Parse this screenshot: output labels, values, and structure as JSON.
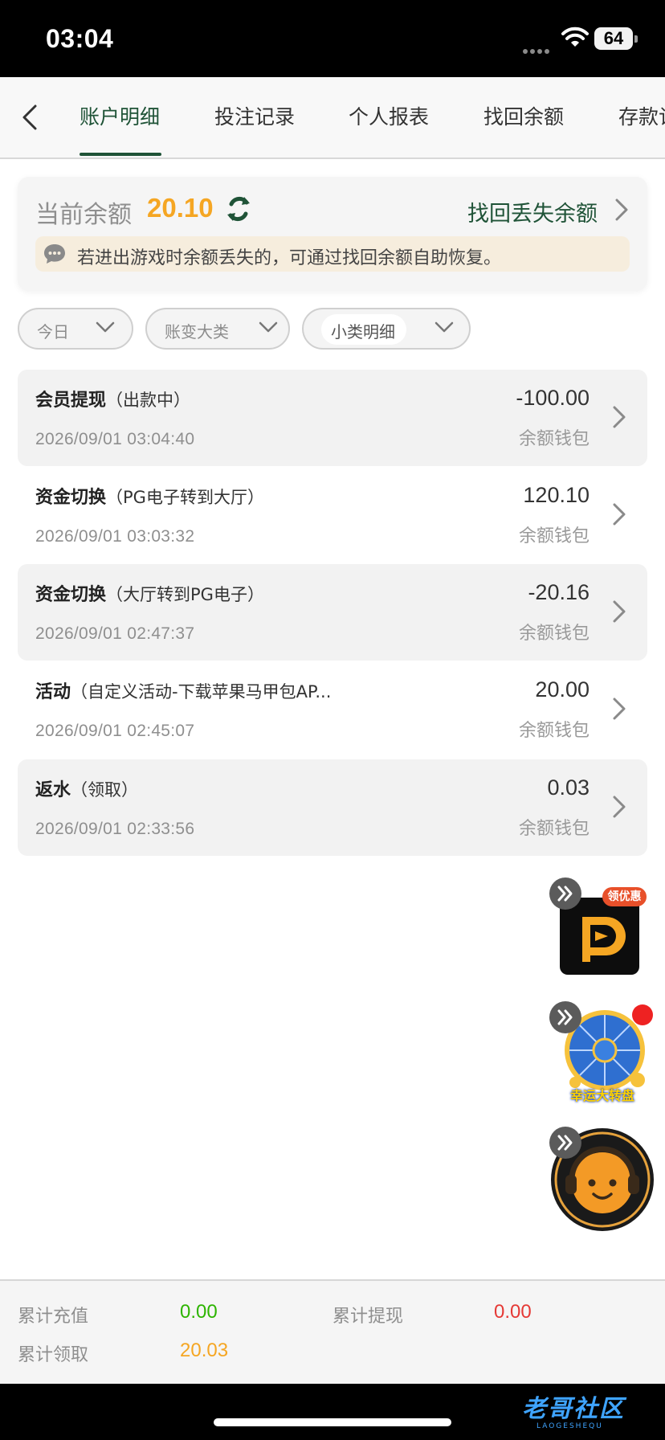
{
  "status_bar": {
    "time": "03:04",
    "battery": "64"
  },
  "tabs": [
    {
      "label": "账户明细",
      "active": true
    },
    {
      "label": "投注记录",
      "active": false
    },
    {
      "label": "个人报表",
      "active": false
    },
    {
      "label": "找回余额",
      "active": false
    },
    {
      "label": "存款记",
      "active": false
    }
  ],
  "balance": {
    "label": "当前余额",
    "value": "20.10",
    "recover_link": "找回丢失余额",
    "notice": "若进出游戏时余额丢失的，可通过找回余额自助恢复。"
  },
  "filters": [
    {
      "label": "今日"
    },
    {
      "label": "账变大类"
    },
    {
      "label": "小类明细"
    }
  ],
  "records": [
    {
      "type": "会员提现",
      "sub": "（出款中）",
      "time": "2026/09/01 03:04:40",
      "amount": "-100.00",
      "wallet": "余额钱包"
    },
    {
      "type": "资金切换",
      "sub": "（PG电子转到大厅）",
      "time": "2026/09/01 03:03:32",
      "amount": "120.10",
      "wallet": "余额钱包"
    },
    {
      "type": "资金切换",
      "sub": "（大厅转到PG电子）",
      "time": "2026/09/01 02:47:37",
      "amount": "-20.16",
      "wallet": "余额钱包"
    },
    {
      "type": "活动",
      "sub": "（自定义活动-下载苹果马甲包AP...",
      "time": "2026/09/01 02:45:07",
      "amount": "20.00",
      "wallet": "余额钱包"
    },
    {
      "type": "返水",
      "sub": "（领取）",
      "time": "2026/09/01 02:33:56",
      "amount": "0.03",
      "wallet": "余额钱包"
    }
  ],
  "floats": {
    "promo_badge": "领优惠",
    "wheel_label": "幸运大转盘"
  },
  "summary": {
    "recharge_label": "累计充值",
    "recharge_value": "0.00",
    "withdraw_label": "累计提现",
    "withdraw_value": "0.00",
    "claim_label": "累计领取",
    "claim_value": "20.03"
  },
  "watermark": {
    "text": "老哥社区",
    "sub": "LAOGESHEQU"
  },
  "colors": {
    "accent": "#1f5337",
    "balance": "#f5a623",
    "green": "#2db400",
    "red": "#e53935",
    "orange": "#f5a623"
  }
}
